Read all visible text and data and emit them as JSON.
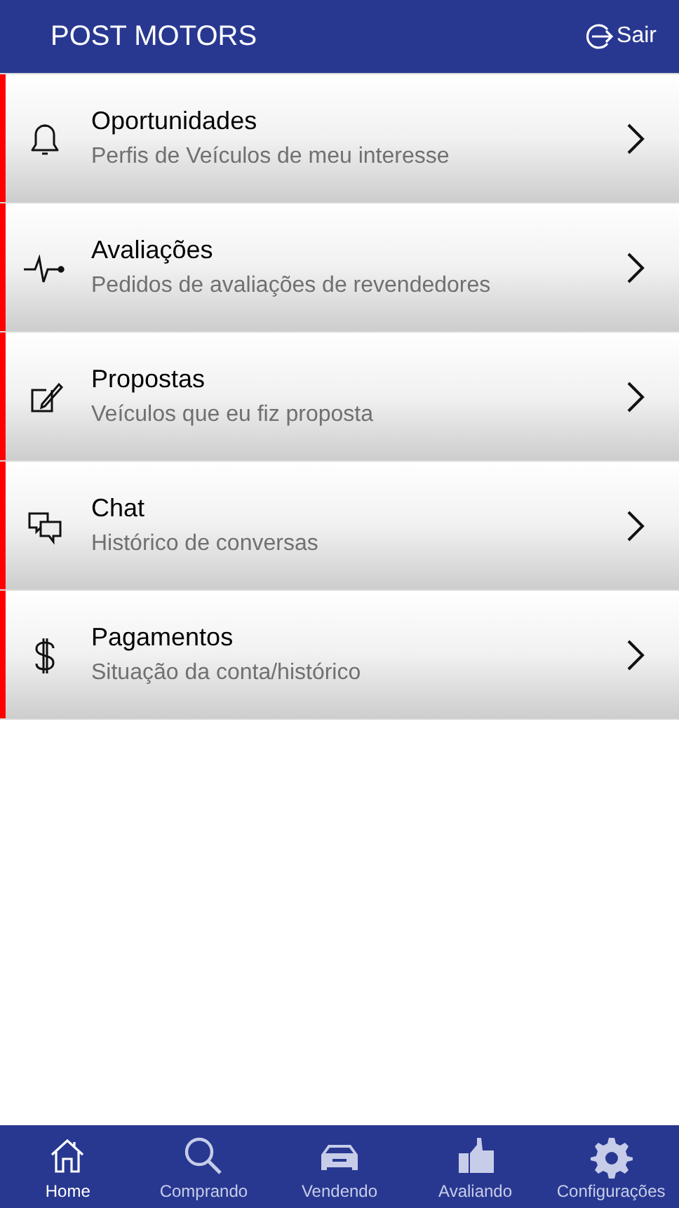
{
  "header": {
    "title": "POST MOTORS",
    "logout": "Sair"
  },
  "menu": [
    {
      "title": "Oportunidades",
      "subtitle": "Perfis de Veículos de meu interesse"
    },
    {
      "title": "Avaliações",
      "subtitle": "Pedidos de avaliações de revendedores"
    },
    {
      "title": "Propostas",
      "subtitle": "Veículos que eu fiz proposta"
    },
    {
      "title": "Chat",
      "subtitle": "Histórico de conversas"
    },
    {
      "title": "Pagamentos",
      "subtitle": "Situação da conta/histórico"
    }
  ],
  "tabs": [
    {
      "label": "Home",
      "selected": true
    },
    {
      "label": "Comprando",
      "selected": false
    },
    {
      "label": "Vendendo",
      "selected": false
    },
    {
      "label": "Avaliando",
      "selected": false
    },
    {
      "label": "Configurações",
      "selected": false
    }
  ]
}
